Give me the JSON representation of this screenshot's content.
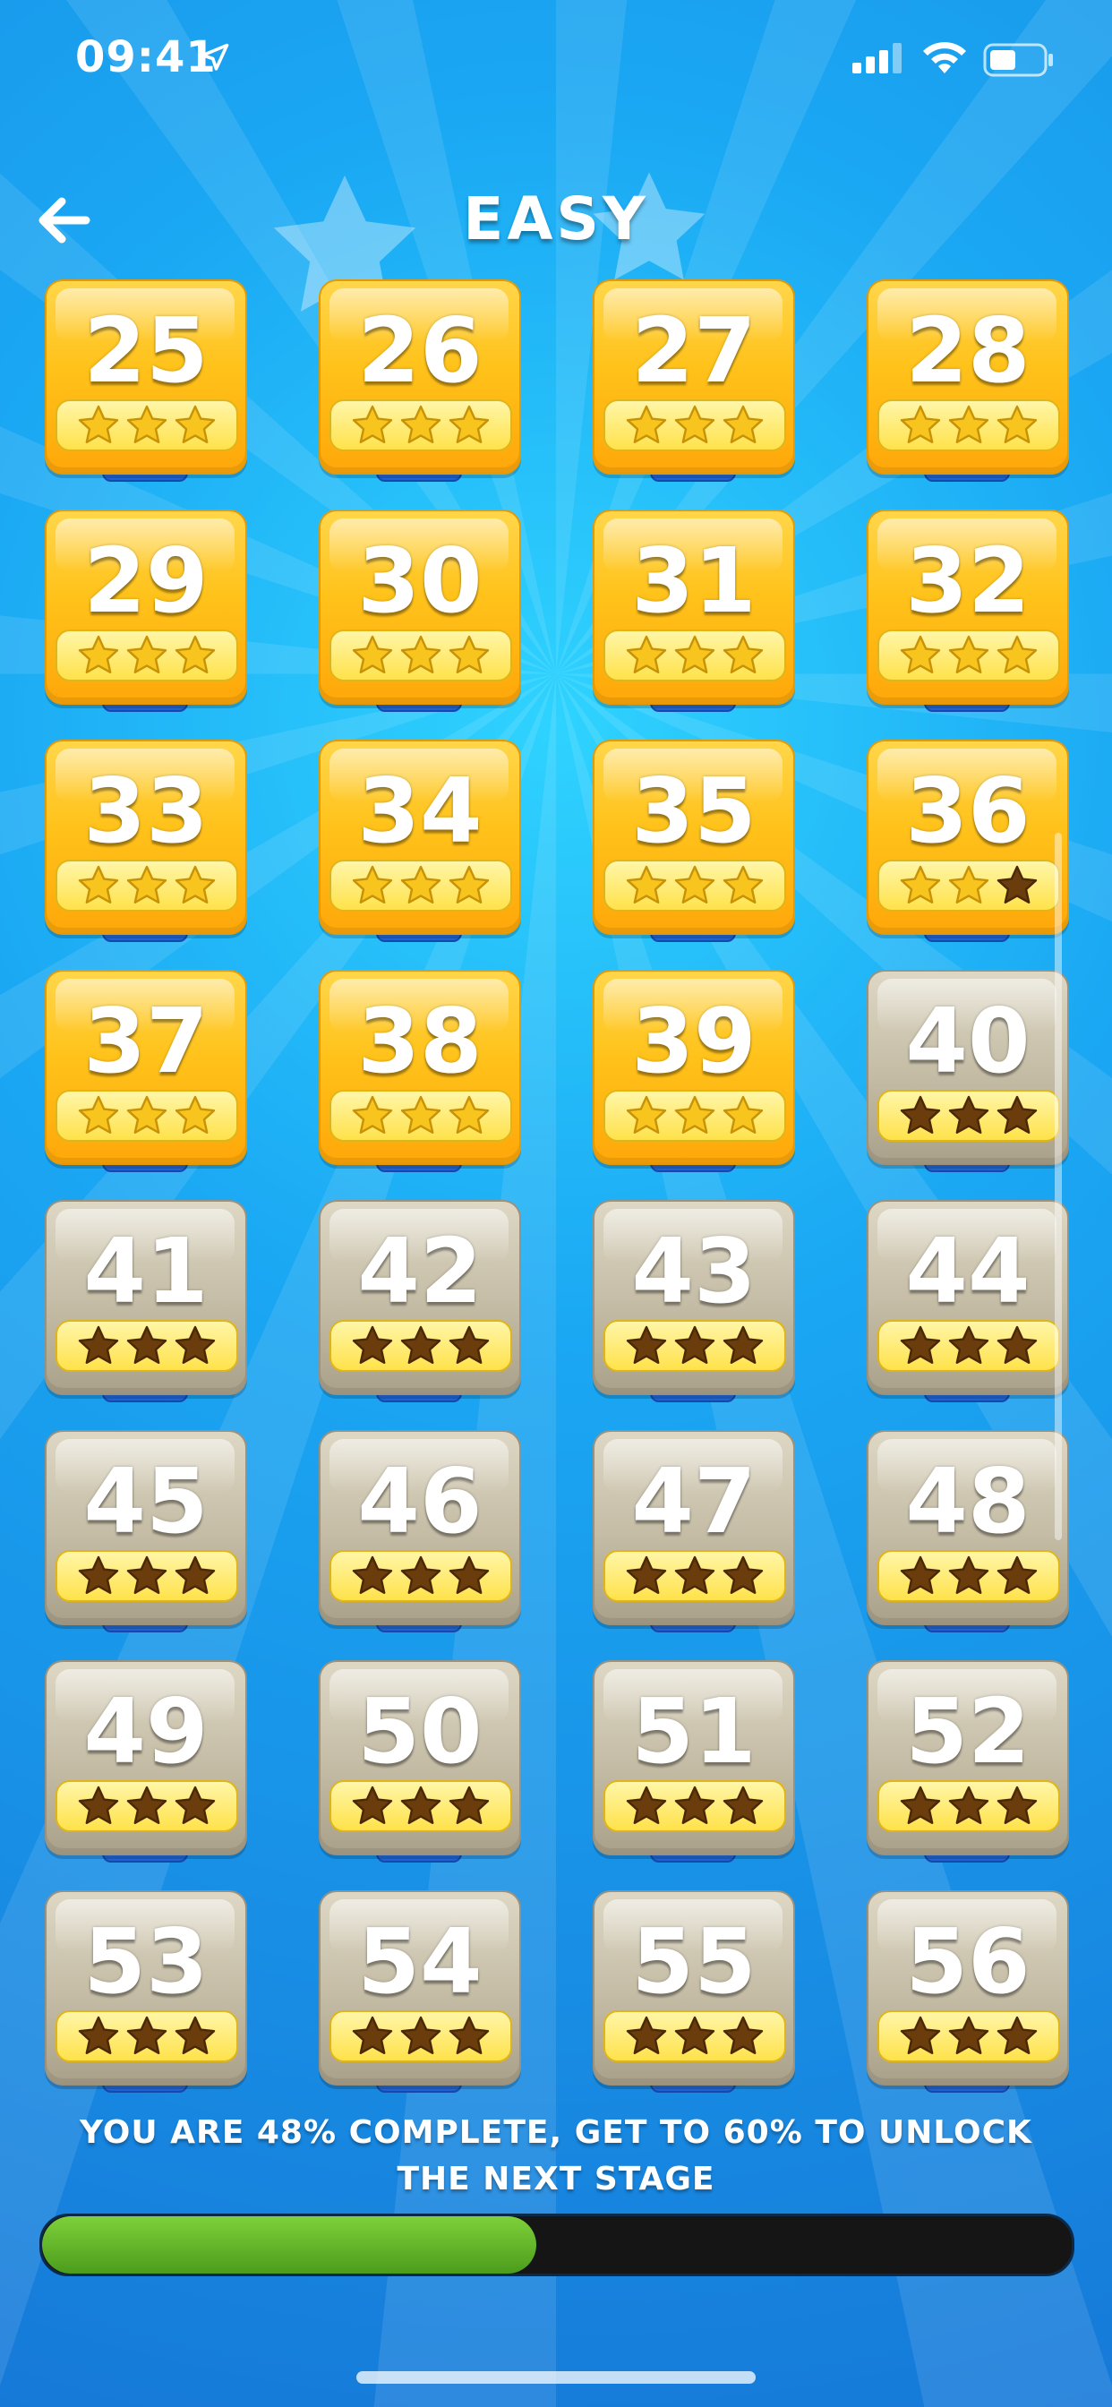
{
  "status_bar": {
    "time": "09:41"
  },
  "header": {
    "title": "EASY"
  },
  "levels": [
    {
      "number": "25",
      "unlocked": true,
      "stars_earned": 3
    },
    {
      "number": "26",
      "unlocked": true,
      "stars_earned": 3
    },
    {
      "number": "27",
      "unlocked": true,
      "stars_earned": 3
    },
    {
      "number": "28",
      "unlocked": true,
      "stars_earned": 3
    },
    {
      "number": "29",
      "unlocked": true,
      "stars_earned": 3
    },
    {
      "number": "30",
      "unlocked": true,
      "stars_earned": 3
    },
    {
      "number": "31",
      "unlocked": true,
      "stars_earned": 3
    },
    {
      "number": "32",
      "unlocked": true,
      "stars_earned": 3
    },
    {
      "number": "33",
      "unlocked": true,
      "stars_earned": 3
    },
    {
      "number": "34",
      "unlocked": true,
      "stars_earned": 3
    },
    {
      "number": "35",
      "unlocked": true,
      "stars_earned": 3
    },
    {
      "number": "36",
      "unlocked": true,
      "stars_earned": 2
    },
    {
      "number": "37",
      "unlocked": true,
      "stars_earned": 3
    },
    {
      "number": "38",
      "unlocked": true,
      "stars_earned": 3
    },
    {
      "number": "39",
      "unlocked": true,
      "stars_earned": 3
    },
    {
      "number": "40",
      "unlocked": false,
      "stars_earned": 0
    },
    {
      "number": "41",
      "unlocked": false,
      "stars_earned": 0
    },
    {
      "number": "42",
      "unlocked": false,
      "stars_earned": 0
    },
    {
      "number": "43",
      "unlocked": false,
      "stars_earned": 0
    },
    {
      "number": "44",
      "unlocked": false,
      "stars_earned": 0
    },
    {
      "number": "45",
      "unlocked": false,
      "stars_earned": 0
    },
    {
      "number": "46",
      "unlocked": false,
      "stars_earned": 0
    },
    {
      "number": "47",
      "unlocked": false,
      "stars_earned": 0
    },
    {
      "number": "48",
      "unlocked": false,
      "stars_earned": 0
    },
    {
      "number": "49",
      "unlocked": false,
      "stars_earned": 0
    },
    {
      "number": "50",
      "unlocked": false,
      "stars_earned": 0
    },
    {
      "number": "51",
      "unlocked": false,
      "stars_earned": 0
    },
    {
      "number": "52",
      "unlocked": false,
      "stars_earned": 0
    },
    {
      "number": "53",
      "unlocked": false,
      "stars_earned": 0
    },
    {
      "number": "54",
      "unlocked": false,
      "stars_earned": 0
    },
    {
      "number": "55",
      "unlocked": false,
      "stars_earned": 0
    },
    {
      "number": "56",
      "unlocked": false,
      "stars_earned": 0
    }
  ],
  "footer": {
    "message": "YOU ARE 48% COMPLETE, GET TO 60% TO UNLOCK THE NEXT STAGE",
    "progress_fraction": 0.48
  },
  "colors": {
    "star_earned": "#f7c51e",
    "star_empty": "#6b3d0c",
    "progress_fill": "#6cc12e"
  }
}
